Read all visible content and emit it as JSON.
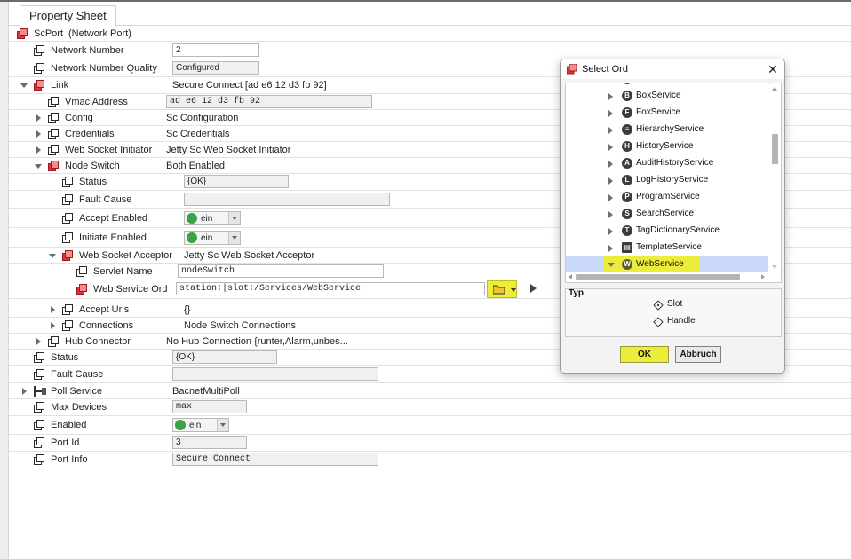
{
  "tab": {
    "label": "Property Sheet"
  },
  "root": {
    "name": "ScPort",
    "type": "(Network Port)"
  },
  "props": {
    "network_number": {
      "label": "Network Number",
      "value": "2"
    },
    "network_number_quality": {
      "label": "Network Number Quality",
      "value": "Configured"
    },
    "link": {
      "label": "Link",
      "value": "Secure Connect [ad e6 12 d3 fb 92]"
    },
    "vmac": {
      "label": "Vmac Address",
      "value": "ad e6 12 d3 fb 92"
    },
    "config": {
      "label": "Config",
      "value": "Sc Configuration"
    },
    "credentials": {
      "label": "Credentials",
      "value": "Sc Credentials"
    },
    "ws_initiator": {
      "label": "Web Socket Initiator",
      "value": "Jetty Sc Web Socket Initiator"
    },
    "node_switch": {
      "label": "Node Switch",
      "value": "Both Enabled"
    },
    "ns_status": {
      "label": "Status",
      "value": "{OK}"
    },
    "ns_fault": {
      "label": "Fault Cause",
      "value": ""
    },
    "accept_enabled": {
      "label": "Accept Enabled",
      "value": "ein"
    },
    "initiate_enabled": {
      "label": "Initiate Enabled",
      "value": "ein"
    },
    "ws_acceptor": {
      "label": "Web Socket Acceptor",
      "value": "Jetty Sc Web Socket Acceptor"
    },
    "servlet_name": {
      "label": "Servlet Name",
      "value": "nodeSwitch"
    },
    "web_service_ord": {
      "label": "Web Service Ord",
      "value": "station:|slot:/Services/WebService"
    },
    "accept_uris": {
      "label": "Accept Uris",
      "value": "{}"
    },
    "connections": {
      "label": "Connections",
      "value": "Node Switch Connections"
    },
    "hub_connector": {
      "label": "Hub Connector",
      "value": "No Hub Connection {runter,Alarm,unbes..."
    },
    "status": {
      "label": "Status",
      "value": "{OK}"
    },
    "fault_cause": {
      "label": "Fault Cause",
      "value": ""
    },
    "poll_service": {
      "label": "Poll Service",
      "value": "BacnetMultiPoll"
    },
    "max_devices": {
      "label": "Max Devices",
      "value": "max"
    },
    "enabled": {
      "label": "Enabled",
      "value": "ein"
    },
    "port_id": {
      "label": "Port Id",
      "value": "3"
    },
    "port_info": {
      "label": "Port Info",
      "value": "Secure Connect"
    }
  },
  "dialog": {
    "title": "Select Ord",
    "close_glyph": "✕",
    "tree": [
      {
        "label": "BoxService",
        "icon": "B"
      },
      {
        "label": "FoxService",
        "icon": "F"
      },
      {
        "label": "HierarchyService",
        "icon": "≡"
      },
      {
        "label": "HistoryService",
        "icon": "H"
      },
      {
        "label": "AuditHistoryService",
        "icon": "A"
      },
      {
        "label": "LogHistoryService",
        "icon": "L"
      },
      {
        "label": "ProgramService",
        "icon": "P"
      },
      {
        "label": "SearchService",
        "icon": "S"
      },
      {
        "label": "TagDictionaryService",
        "icon": "T"
      },
      {
        "label": "TemplateService",
        "icon": "▤"
      },
      {
        "label": "WebService",
        "icon": "W",
        "selected": true
      }
    ],
    "typ": {
      "legend": "Typ",
      "options": [
        {
          "label": "Slot",
          "selected": true
        },
        {
          "label": "Handle",
          "selected": false
        }
      ]
    },
    "ok_label": "OK",
    "cancel_label": "Abbruch"
  },
  "colors": {
    "highlight_yellow": "#ecec3a",
    "status_green": "#3aa347",
    "component_red": "#e0343a",
    "selection_blue": "#c9d9f7"
  }
}
